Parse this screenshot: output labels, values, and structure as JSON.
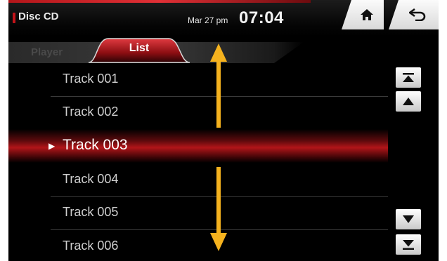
{
  "header": {
    "source_title": "Disc CD",
    "date": "Mar 27 pm",
    "time": "07:04",
    "home_icon": "home-icon",
    "back_icon": "back-arrow-icon"
  },
  "tabs": [
    {
      "label": "Player",
      "active": false
    },
    {
      "label": "List",
      "active": true
    }
  ],
  "tracks": [
    {
      "label": "Track 001",
      "selected": false
    },
    {
      "label": "Track 002",
      "selected": false
    },
    {
      "label": "Track 003",
      "selected": true
    },
    {
      "label": "Track 004",
      "selected": false
    },
    {
      "label": "Track 005",
      "selected": false
    },
    {
      "label": "Track 006",
      "selected": false
    }
  ],
  "side_controls": [
    {
      "name": "scroll-to-top-button",
      "icon": "skip-to-top-icon"
    },
    {
      "name": "page-up-button",
      "icon": "triangle-up-icon"
    },
    {
      "name": "page-down-button",
      "icon": "triangle-down-icon"
    },
    {
      "name": "scroll-to-bottom-button",
      "icon": "skip-to-bottom-icon"
    }
  ],
  "colors": {
    "accent_red": "#c4141a",
    "scroll_hint_arrow": "#f5b21e",
    "background": "#000000"
  }
}
